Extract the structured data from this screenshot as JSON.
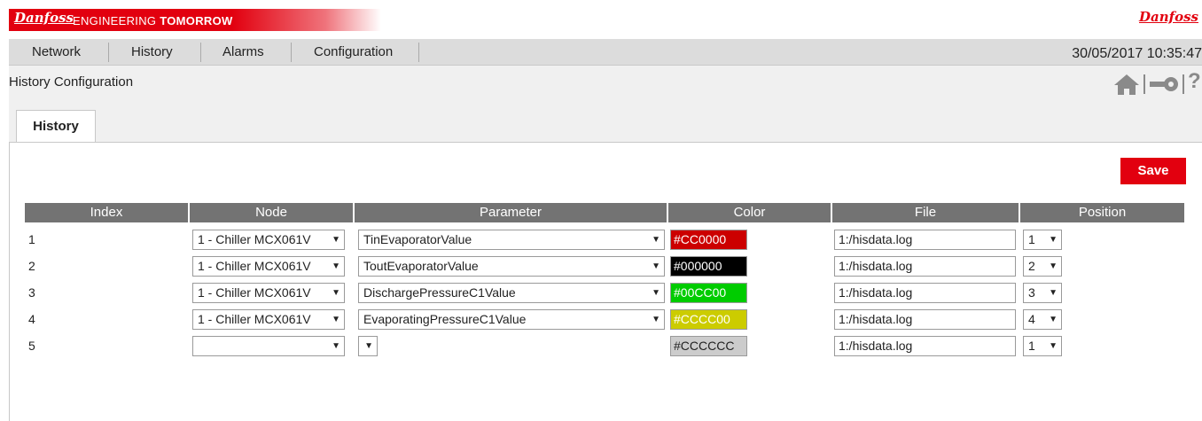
{
  "banner": {
    "logo": "Danfoss",
    "tagline_a": "ENGINEERING ",
    "tagline_b": "TOMORROW",
    "logo_right": "Danfoss"
  },
  "nav": {
    "items": [
      "Network",
      "History",
      "Alarms",
      "Configuration"
    ],
    "datetime": "30/05/2017 10:35:47"
  },
  "page": {
    "title": "History Configuration",
    "tab": "History",
    "save_label": "Save",
    "help_icon": "?"
  },
  "icons": {
    "home": "home-icon",
    "key": "key-icon",
    "help": "help-icon"
  },
  "colors": {
    "brand": "#E2000F",
    "header": "#737373"
  },
  "table": {
    "headers": [
      "Index",
      "Node",
      "Parameter",
      "Color",
      "File",
      "Position"
    ],
    "rows": [
      {
        "index": "1",
        "node": "1 - Chiller MCX061V",
        "parameter": "TinEvaporatorValue",
        "color": "#CC0000",
        "file": "1:/hisdata.log",
        "position": "1"
      },
      {
        "index": "2",
        "node": "1 - Chiller MCX061V",
        "parameter": "ToutEvaporatorValue",
        "color": "#000000",
        "file": "1:/hisdata.log",
        "position": "2"
      },
      {
        "index": "3",
        "node": "1 - Chiller MCX061V",
        "parameter": "DischargePressureC1Value",
        "color": "#00CC00",
        "file": "1:/hisdata.log",
        "position": "3"
      },
      {
        "index": "4",
        "node": "1 - Chiller MCX061V",
        "parameter": "EvaporatingPressureC1Value",
        "color": "#CCCC00",
        "file": "1:/hisdata.log",
        "position": "4"
      },
      {
        "index": "5",
        "node": "",
        "parameter": "",
        "color": "#CCCCCC",
        "file": "1:/hisdata.log",
        "position": "1"
      }
    ]
  }
}
